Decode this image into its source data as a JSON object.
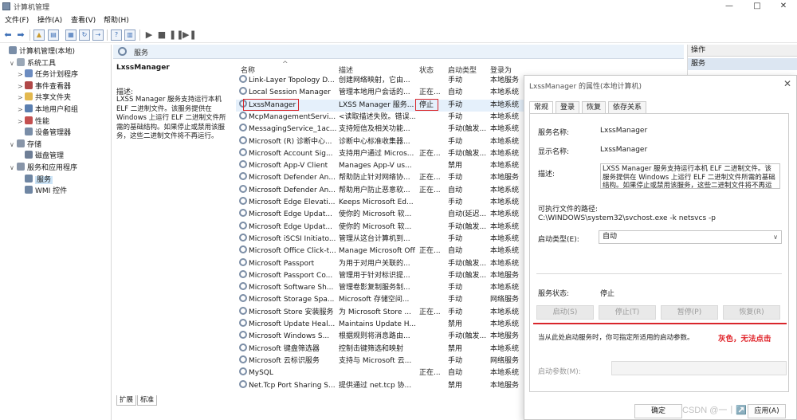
{
  "window": {
    "title": "计算机管理"
  },
  "menu": [
    "文件(F)",
    "操作(A)",
    "查看(V)",
    "帮助(H)"
  ],
  "tree": [
    {
      "label": "计算机管理(本地)",
      "indent": 0,
      "twisty": "",
      "color": "#7a8ea8"
    },
    {
      "label": "系统工具",
      "indent": 1,
      "twisty": "∨",
      "color": "#9aa7b6"
    },
    {
      "label": "任务计划程序",
      "indent": 2,
      "twisty": ">",
      "color": "#6c8cc0"
    },
    {
      "label": "事件查看器",
      "indent": 2,
      "twisty": ">",
      "color": "#b04848"
    },
    {
      "label": "共享文件夹",
      "indent": 2,
      "twisty": ">",
      "color": "#e3b84e"
    },
    {
      "label": "本地用户和组",
      "indent": 2,
      "twisty": ">",
      "color": "#5b7fb0"
    },
    {
      "label": "性能",
      "indent": 2,
      "twisty": ">",
      "color": "#c45050"
    },
    {
      "label": "设备管理器",
      "indent": 2,
      "twisty": "",
      "color": "#7a8ea8"
    },
    {
      "label": "存储",
      "indent": 1,
      "twisty": "∨",
      "color": "#8895a8"
    },
    {
      "label": "磁盘管理",
      "indent": 2,
      "twisty": "",
      "color": "#6e7e96"
    },
    {
      "label": "服务和应用程序",
      "indent": 1,
      "twisty": "∨",
      "color": "#8895a8"
    },
    {
      "label": "服务",
      "indent": 2,
      "twisty": "",
      "color": "#6f86a3",
      "selected": true
    },
    {
      "label": "WMI 控件",
      "indent": 2,
      "twisty": "",
      "color": "#6f86a3"
    }
  ],
  "header": {
    "title": "服务"
  },
  "description_panel": {
    "service_name": "LxssManager",
    "label": "描述:",
    "text": "LXSS Manager 服务支持运行本机 ELF 二进制文件。该服务提供在 Windows 上运行 ELF 二进制文件所需的基础结构。如果停止或禁用该服务，这些二进制文件将不再运行。"
  },
  "columns": [
    "名称",
    "描述",
    "状态",
    "启动类型",
    "登录为"
  ],
  "services": [
    {
      "name": "Link-Layer Topology D...",
      "desc": "创建网络映射，它由...",
      "status": "",
      "type": "手动",
      "logon": "本地服务"
    },
    {
      "name": "Local Session Manager",
      "desc": "管理本地用户会话的...",
      "status": "正在...",
      "type": "自动",
      "logon": "本地系统"
    },
    {
      "name": "LxssManager",
      "desc": "LXSS Manager 服务...",
      "status": "停止",
      "type": "手动",
      "logon": "本地系统"
    },
    {
      "name": "McpManagementServi...",
      "desc": "<读取描述失败。错误...",
      "status": "",
      "type": "手动",
      "logon": "本地系统"
    },
    {
      "name": "MessagingService_1ac...",
      "desc": "支持短信及相关功能...",
      "status": "",
      "type": "手动(触发...",
      "logon": "本地系统"
    },
    {
      "name": "Microsoft (R) 诊断中心...",
      "desc": "诊断中心标准收集器...",
      "status": "",
      "type": "手动",
      "logon": "本地系统"
    },
    {
      "name": "Microsoft Account Sig...",
      "desc": "支持用户通过 Micros...",
      "status": "正在...",
      "type": "手动(触发...",
      "logon": "本地系统"
    },
    {
      "name": "Microsoft App-V Client",
      "desc": "Manages App-V us...",
      "status": "",
      "type": "禁用",
      "logon": "本地系统"
    },
    {
      "name": "Microsoft Defender An...",
      "desc": "帮助防止针对网络协...",
      "status": "正在...",
      "type": "手动",
      "logon": "本地服务"
    },
    {
      "name": "Microsoft Defender An...",
      "desc": "帮助用户防止恶意软...",
      "status": "正在...",
      "type": "自动",
      "logon": "本地系统"
    },
    {
      "name": "Microsoft Edge Elevati...",
      "desc": "Keeps Microsoft Ed...",
      "status": "",
      "type": "手动",
      "logon": "本地系统"
    },
    {
      "name": "Microsoft Edge Updat...",
      "desc": "使你的 Microsoft 软...",
      "status": "",
      "type": "自动(延迟...",
      "logon": "本地系统"
    },
    {
      "name": "Microsoft Edge Updat...",
      "desc": "使你的 Microsoft 软...",
      "status": "",
      "type": "手动(触发...",
      "logon": "本地系统"
    },
    {
      "name": "Microsoft iSCSI Initiato...",
      "desc": "管理从这台计算机到...",
      "status": "",
      "type": "手动",
      "logon": "本地系统"
    },
    {
      "name": "Microsoft Office Click-t...",
      "desc": "Manage Microsoft Offic...",
      "status": "正在...",
      "type": "自动",
      "logon": "本地系统"
    },
    {
      "name": "Microsoft Passport",
      "desc": "为用于对用户关联的...",
      "status": "",
      "type": "手动(触发...",
      "logon": "本地系统"
    },
    {
      "name": "Microsoft Passport Co...",
      "desc": "管理用于针对标识提...",
      "status": "",
      "type": "手动(触发...",
      "logon": "本地服务"
    },
    {
      "name": "Microsoft Software Sh...",
      "desc": "管理卷影复制服务制...",
      "status": "",
      "type": "手动",
      "logon": "本地系统"
    },
    {
      "name": "Microsoft Storage Spa...",
      "desc": "Microsoft 存储空间...",
      "status": "",
      "type": "手动",
      "logon": "网络服务"
    },
    {
      "name": "Microsoft Store 安装服务",
      "desc": "为 Microsoft Store ...",
      "status": "正在...",
      "type": "手动",
      "logon": "本地系统"
    },
    {
      "name": "Microsoft Update Heal...",
      "desc": "Maintains Update H...",
      "status": "",
      "type": "禁用",
      "logon": "本地系统"
    },
    {
      "name": "Microsoft Windows S...",
      "desc": "根据规则将消息路由...",
      "status": "",
      "type": "手动(触发...",
      "logon": "本地服务"
    },
    {
      "name": "Microsoft 键盘筛选器",
      "desc": "控制击键筛选和映射",
      "status": "",
      "type": "禁用",
      "logon": "本地系统"
    },
    {
      "name": "Microsoft 云标识服务",
      "desc": "支持与 Microsoft 云...",
      "status": "",
      "type": "手动",
      "logon": "网络服务"
    },
    {
      "name": "MySQL",
      "desc": "",
      "status": "正在...",
      "type": "自动",
      "logon": "本地系统"
    },
    {
      "name": "Net.Tcp Port Sharing S...",
      "desc": "提供通过 net.tcp 协...",
      "status": "",
      "type": "禁用",
      "logon": "本地服务"
    }
  ],
  "bottom_tabs": [
    "扩展",
    "标准"
  ],
  "actions": {
    "header": "操作",
    "sub": "服务"
  },
  "dialog": {
    "title": "LxssManager 的属性(本地计算机)",
    "tabs": [
      "常规",
      "登录",
      "恢复",
      "依存关系"
    ],
    "service_name_label": "服务名称:",
    "service_name": "LxssManager",
    "display_name_label": "显示名称:",
    "display_name": "LxssManager",
    "desc_label": "描述:",
    "desc": "LXSS Manager 服务支持运行本机 ELF 二进制文件。该服务提供在 Windows 上运行 ELF 二进制文件所需的基础结构。如果停止或禁用该服务，这些二进制文件将不再运行。",
    "path_label": "可执行文件的路径:",
    "path": "C:\\WINDOWS\\system32\\svchost.exe -k netsvcs -p",
    "startup_label": "启动类型(E):",
    "startup_value": "自动",
    "status_label": "服务状态:",
    "status_value": "停止",
    "buttons": [
      "启动(S)",
      "停止(T)",
      "暂停(P)",
      "恢复(R)"
    ],
    "hint": "当从此处启动服务时，你可指定所适用的启动参数。",
    "annotation": "灰色，无法点击",
    "params_label": "启动参数(M):",
    "ok": "确定",
    "apply": "应用(A)",
    "watermark": "CSDN @一丨↗️7"
  }
}
